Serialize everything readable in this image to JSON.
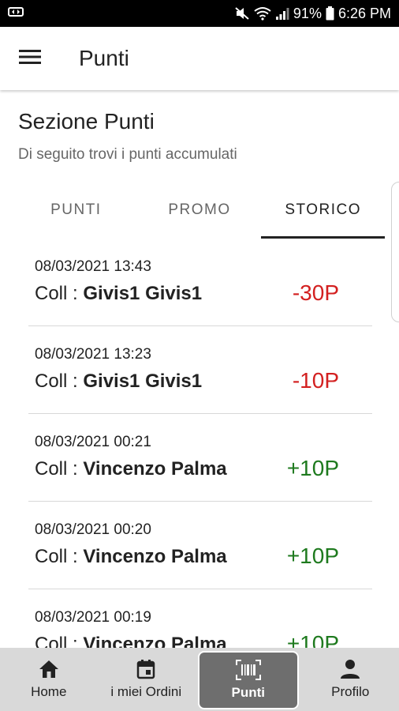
{
  "status_bar": {
    "battery": "91%",
    "time": "6:26 PM",
    "icons": [
      "wallet-icon",
      "mute-icon",
      "wifi-icon",
      "signal-icon",
      "battery-icon"
    ]
  },
  "app_bar": {
    "title": "Punti",
    "menu_icon": "hamburger-menu-icon"
  },
  "header": {
    "title": "Sezione Punti",
    "subtitle": "Di seguito trovi i punti accumulati"
  },
  "tabs": [
    {
      "label": "PUNTI",
      "active": false
    },
    {
      "label": "PROMO",
      "active": false
    },
    {
      "label": "STORICO",
      "active": true
    }
  ],
  "history": [
    {
      "date": "08/03/2021 13:43",
      "prefix": "Coll : ",
      "name": "Givis1 Givis1",
      "points": "-30P",
      "sign": "neg"
    },
    {
      "date": "08/03/2021 13:23",
      "prefix": "Coll : ",
      "name": "Givis1 Givis1",
      "points": "-10P",
      "sign": "neg"
    },
    {
      "date": "08/03/2021 00:21",
      "prefix": "Coll : ",
      "name": "Vincenzo Palma",
      "points": "+10P",
      "sign": "pos"
    },
    {
      "date": "08/03/2021 00:20",
      "prefix": "Coll : ",
      "name": "Vincenzo Palma",
      "points": "+10P",
      "sign": "pos"
    },
    {
      "date": "08/03/2021 00:19",
      "prefix": "Coll : ",
      "name": "Vincenzo Palma",
      "points": "+10P",
      "sign": "pos"
    }
  ],
  "bottom_nav": [
    {
      "label": "Home",
      "icon": "home-icon",
      "active": false
    },
    {
      "label": "i miei Ordini",
      "icon": "calendar-icon",
      "active": false
    },
    {
      "label": "Punti",
      "icon": "barcode-icon",
      "active": true
    },
    {
      "label": "Profilo",
      "icon": "person-icon",
      "active": false
    }
  ],
  "colors": {
    "negative": "#d32020",
    "positive": "#1e7a1e",
    "nav_background": "#d9d9d9",
    "nav_active": "#6e6e6e"
  }
}
